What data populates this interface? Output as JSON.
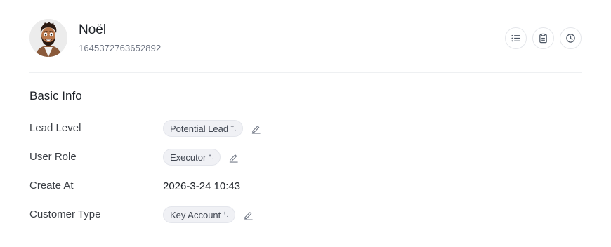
{
  "profile": {
    "name": "Noël",
    "id": "1645372763652892",
    "avatar_icon": "cartoon-avatar"
  },
  "header_actions": [
    {
      "icon": "list-icon"
    },
    {
      "icon": "clipboard-icon"
    },
    {
      "icon": "clock-icon"
    }
  ],
  "section": {
    "title": "Basic Info"
  },
  "fields": {
    "lead_level": {
      "label": "Lead Level",
      "value": "Potential Lead",
      "spark": "⁺."
    },
    "user_role": {
      "label": "User Role",
      "value": "Executor",
      "spark": "⁺."
    },
    "create_at": {
      "label": "Create At",
      "value": "2026-3-24 10:43"
    },
    "customer_type": {
      "label": "Customer Type",
      "value": "Key Account",
      "spark": "⁺."
    }
  },
  "colors": {
    "tag_bg": "#f0f1f5",
    "divider": "#eef0f2",
    "muted_text": "#6b7280"
  }
}
